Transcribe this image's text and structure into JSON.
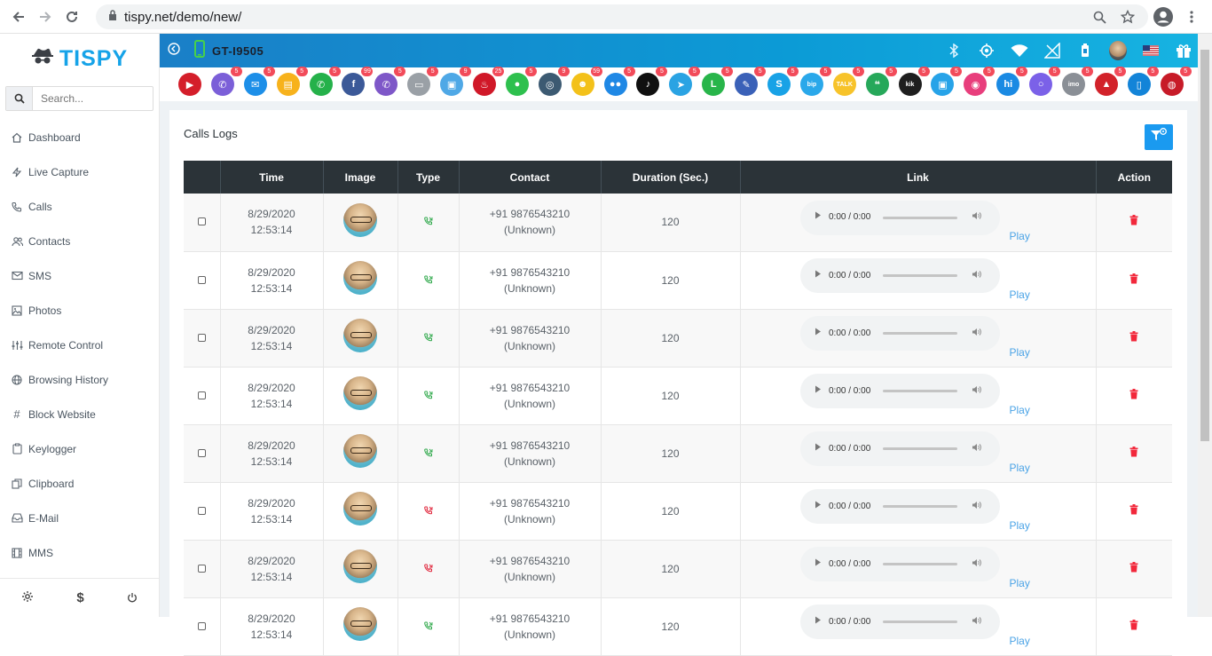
{
  "browser": {
    "url": "tispy.net/demo/new/"
  },
  "sidebar": {
    "logo": "TISPY",
    "search_placeholder": "Search...",
    "items": [
      {
        "label": "Dashboard",
        "icon": "home-icon"
      },
      {
        "label": "Live Capture",
        "icon": "bolt-icon"
      },
      {
        "label": "Calls",
        "icon": "phone-icon"
      },
      {
        "label": "Contacts",
        "icon": "users-icon"
      },
      {
        "label": "SMS",
        "icon": "envelope-icon"
      },
      {
        "label": "Photos",
        "icon": "image-icon"
      },
      {
        "label": "Remote Control",
        "icon": "sliders-icon"
      },
      {
        "label": "Browsing History",
        "icon": "globe-icon"
      },
      {
        "label": "Block Website",
        "icon": "hash-icon"
      },
      {
        "label": "Keylogger",
        "icon": "clipboard-icon"
      },
      {
        "label": "Clipboard",
        "icon": "copy-icon"
      },
      {
        "label": "E-Mail",
        "icon": "inbox-icon"
      },
      {
        "label": "MMS",
        "icon": "film-icon"
      }
    ]
  },
  "topbar": {
    "device_name": "GT-I9505"
  },
  "apps": [
    {
      "name": "screen-recorder",
      "color": "#d41e2a",
      "glyph": "▶",
      "badge": ""
    },
    {
      "name": "viber",
      "color": "#7b5fd8",
      "glyph": "✆",
      "badge": "5"
    },
    {
      "name": "mail",
      "color": "#1d8fe8",
      "glyph": "✉",
      "badge": "5"
    },
    {
      "name": "notes",
      "color": "#f7b21c",
      "glyph": "▤",
      "badge": "5"
    },
    {
      "name": "whatsapp",
      "color": "#25b14a",
      "glyph": "✆",
      "badge": "5"
    },
    {
      "name": "facebook",
      "color": "#3b5998",
      "glyph": "f",
      "badge": "99"
    },
    {
      "name": "viber-2",
      "color": "#7e57c8",
      "glyph": "✆",
      "badge": "5"
    },
    {
      "name": "files",
      "color": "#9aa0a6",
      "glyph": "▭",
      "badge": "5"
    },
    {
      "name": "gallery",
      "color": "#4fa8e6",
      "glyph": "▣",
      "badge": "9"
    },
    {
      "name": "tinder",
      "color": "#d01828",
      "glyph": "♨",
      "badge": "25"
    },
    {
      "name": "wechat",
      "color": "#2ec04e",
      "glyph": "●",
      "badge": "5"
    },
    {
      "name": "instagram",
      "color": "#3c5a72",
      "glyph": "◎",
      "badge": "9"
    },
    {
      "name": "snapchat",
      "color": "#f3c11a",
      "glyph": "☻",
      "badge": "59"
    },
    {
      "name": "flickr",
      "color": "#1f88e5",
      "glyph": "●●",
      "badge": "5"
    },
    {
      "name": "tiktok",
      "color": "#101010",
      "glyph": "♪",
      "badge": "5"
    },
    {
      "name": "telegram",
      "color": "#2aa3e3",
      "glyph": "➤",
      "badge": "5"
    },
    {
      "name": "line",
      "color": "#28b54a",
      "glyph": "L",
      "badge": "5"
    },
    {
      "name": "messenger",
      "color": "#3a61b8",
      "glyph": "✎",
      "badge": "5"
    },
    {
      "name": "skype",
      "color": "#18a2e6",
      "glyph": "S",
      "badge": "5"
    },
    {
      "name": "bip",
      "color": "#2aa8ea",
      "glyph": "bip",
      "badge": "5"
    },
    {
      "name": "talk",
      "color": "#f7c32a",
      "glyph": "TALK",
      "badge": "5"
    },
    {
      "name": "hangouts",
      "color": "#26a85a",
      "glyph": "❝",
      "badge": "5"
    },
    {
      "name": "kik",
      "color": "#1e1e1e",
      "glyph": "kik",
      "badge": "5"
    },
    {
      "name": "chat",
      "color": "#27a3e8",
      "glyph": "▣",
      "badge": "5"
    },
    {
      "name": "video-chat",
      "color": "#e83e7c",
      "glyph": "◉",
      "badge": "5"
    },
    {
      "name": "hike",
      "color": "#1a8ae3",
      "glyph": "hi",
      "badge": "5"
    },
    {
      "name": "signal",
      "color": "#7b61e8",
      "glyph": "○",
      "badge": "5"
    },
    {
      "name": "imo",
      "color": "#8a8f96",
      "glyph": "imo",
      "badge": "5"
    },
    {
      "name": "photos",
      "color": "#d2222a",
      "glyph": "▲",
      "badge": "5"
    },
    {
      "name": "phone",
      "color": "#1384d8",
      "glyph": "▯",
      "badge": "5"
    },
    {
      "name": "browser",
      "color": "#c71b28",
      "glyph": "◍",
      "badge": "5"
    }
  ],
  "main": {
    "title": "Calls Logs",
    "columns": [
      "",
      "Time",
      "Image",
      "Type",
      "Contact",
      "Duration (Sec.)",
      "Link",
      "Action"
    ],
    "audio_time": "0:00 / 0:00",
    "play_label": "Play",
    "rows": [
      {
        "date": "8/29/2020",
        "time": "12:53:14",
        "type": "incoming",
        "type_color": "#2ea84a",
        "number": "+91 9876543210",
        "contact": "(Unknown)",
        "duration": "120"
      },
      {
        "date": "8/29/2020",
        "time": "12:53:14",
        "type": "incoming",
        "type_color": "#2ea84a",
        "number": "+91 9876543210",
        "contact": "(Unknown)",
        "duration": "120"
      },
      {
        "date": "8/29/2020",
        "time": "12:53:14",
        "type": "incoming",
        "type_color": "#2ea84a",
        "number": "+91 9876543210",
        "contact": "(Unknown)",
        "duration": "120"
      },
      {
        "date": "8/29/2020",
        "time": "12:53:14",
        "type": "incoming",
        "type_color": "#2ea84a",
        "number": "+91 9876543210",
        "contact": "(Unknown)",
        "duration": "120"
      },
      {
        "date": "8/29/2020",
        "time": "12:53:14",
        "type": "incoming",
        "type_color": "#2ea84a",
        "number": "+91 9876543210",
        "contact": "(Unknown)",
        "duration": "120"
      },
      {
        "date": "8/29/2020",
        "time": "12:53:14",
        "type": "missed",
        "type_color": "#e0243a",
        "number": "+91 9876543210",
        "contact": "(Unknown)",
        "duration": "120"
      },
      {
        "date": "8/29/2020",
        "time": "12:53:14",
        "type": "missed",
        "type_color": "#e0243a",
        "number": "+91 9876543210",
        "contact": "(Unknown)",
        "duration": "120"
      },
      {
        "date": "8/29/2020",
        "time": "12:53:14",
        "type": "incoming",
        "type_color": "#2ea84a",
        "number": "+91 9876543210",
        "contact": "(Unknown)",
        "duration": "120"
      }
    ]
  }
}
